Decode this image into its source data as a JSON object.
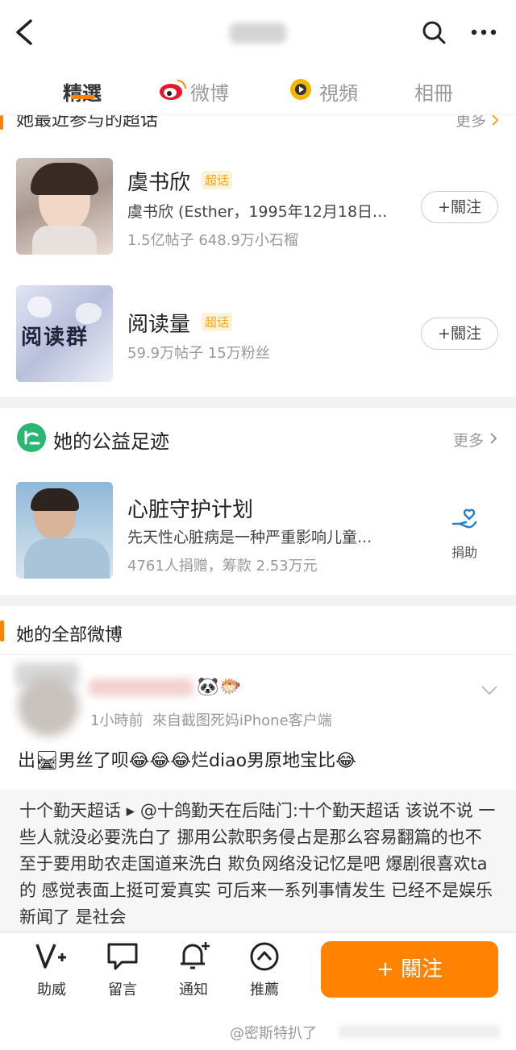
{
  "tabs": [
    {
      "label": "精選"
    },
    {
      "label": "微博"
    },
    {
      "label": "視頻"
    },
    {
      "label": "相冊"
    }
  ],
  "supertopics": {
    "title": "她最近参与的超话",
    "more": "更多",
    "items": [
      {
        "name": "虞书欣",
        "tag": "超话",
        "desc": "虞书欣 (Esther，1995年12月18日...",
        "meta": "1.5亿帖子 648.9万小石榴",
        "follow": "+關注"
      },
      {
        "name": "阅读量",
        "tag": "超话",
        "cover_text": "阅读群",
        "meta": "59.9万帖子 15万粉丝",
        "follow": "+關注"
      }
    ]
  },
  "charity": {
    "title": "她的公益足迹",
    "more": "更多",
    "item": {
      "name": "心脏守护计划",
      "desc": "先天性心脏病是一种严重影响儿童...",
      "meta": "4761人捐赠，筹款 2.53万元",
      "action": "捐助"
    }
  },
  "all_weibo": {
    "title": "她的全部微博",
    "post": {
      "time_source": "1小時前  來自截图死妈iPhone客户端",
      "text": "出🛤男丝了呗😂😂😂烂diao男原地宝比😂",
      "repost": "十个勤天超话 ▸ @十鸽勤天在后陆门:十个勤天超话 该说不说 一些人就没必要洗白了 挪用公款职务侵占是那么容易翻篇的也不至于要用助农走国道来洗白 欺负网络没记忆是吧 爆剧很喜欢ta的 感觉表面上挺可爱真实 可后来一系列事情发生 已经不是娱乐新闻了 是社会"
    }
  },
  "bottom_bar": {
    "items": [
      {
        "label": "助威",
        "icon": "cheer-icon"
      },
      {
        "label": "留言",
        "icon": "comment-icon"
      },
      {
        "label": "通知",
        "icon": "bell-plus-icon"
      },
      {
        "label": "推薦",
        "icon": "recommend-icon"
      }
    ],
    "follow": "+ 關注"
  },
  "watermark": "@密斯特扒了",
  "colors": {
    "accent": "#ff8200",
    "tag_bg": "#fff2d6",
    "charity_green": "#2bb673"
  }
}
